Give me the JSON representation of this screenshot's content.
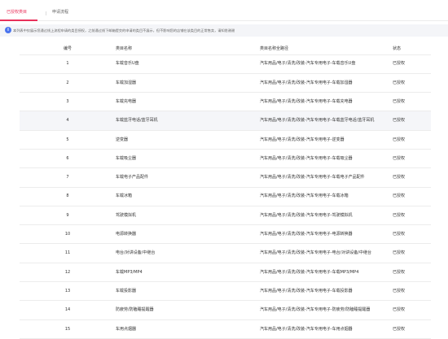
{
  "tabs": {
    "active_label": "已授权类目",
    "other_label": "申请流程"
  },
  "notice": {
    "icon": "info-icon",
    "text": "本列表中仅展示您通过线上流程申请的类目授权，之前通过线下邮箱提交的申请的类目不展示，但不影响您的店铺在该类目的正常售卖，请知悉谢谢"
  },
  "table": {
    "columns": [
      "编号",
      "类目名称",
      "类目名称全路径",
      "状态"
    ],
    "rows": [
      {
        "id": "1",
        "name": "车载音乐U盘",
        "path": "汽车用品/电子/清洗/改装-汽车专用电子-车载音乐U盘",
        "status": "已授权"
      },
      {
        "id": "2",
        "name": "车载加湿器",
        "path": "汽车用品/电子/清洗/改装-汽车专用电子-车载加湿器",
        "status": "已授权"
      },
      {
        "id": "3",
        "name": "车载充电器",
        "path": "汽车用品/电子/清洗/改装-汽车专用电子-车载充电器",
        "status": "已授权"
      },
      {
        "id": "4",
        "name": "车载蓝牙电话/蓝牙耳机",
        "path": "汽车用品/电子/清洗/改装-汽车专用电子-车载蓝牙电话/蓝牙耳机",
        "status": "已授权"
      },
      {
        "id": "5",
        "name": "逆变器",
        "path": "汽车用品/电子/清洗/改装-汽车专用电子-逆变器",
        "status": "已授权"
      },
      {
        "id": "6",
        "name": "车载吸尘器",
        "path": "汽车用品/电子/清洗/改装-汽车专用电子-车载吸尘器",
        "status": "已授权"
      },
      {
        "id": "7",
        "name": "车载电子产品配件",
        "path": "汽车用品/电子/清洗/改装-汽车专用电子-车载电子产品配件",
        "status": "已授权"
      },
      {
        "id": "8",
        "name": "车载冰箱",
        "path": "汽车用品/电子/清洗/改装-汽车专用电子-车载冰箱",
        "status": "已授权"
      },
      {
        "id": "9",
        "name": "驾驶模拟机",
        "path": "汽车用品/电子/清洗/改装-汽车专用电子-驾驶模拟机",
        "status": "已授权"
      },
      {
        "id": "10",
        "name": "电源转换器",
        "path": "汽车用品/电子/清洗/改装-汽车专用电子-电源转换器",
        "status": "已授权"
      },
      {
        "id": "11",
        "name": "电台/对讲设备/中继台",
        "path": "汽车用品/电子/清洗/改装-汽车专用电子-电台/对讲设备/中继台",
        "status": "已授权"
      },
      {
        "id": "12",
        "name": "车载MP3/MP4",
        "path": "汽车用品/电子/清洗/改装-汽车专用电子-车载MP3/MP4",
        "status": "已授权"
      },
      {
        "id": "13",
        "name": "车载投影器",
        "path": "汽车用品/电子/清洗/改装-汽车专用电子-车载投影器",
        "status": "已授权"
      },
      {
        "id": "14",
        "name": "防疲劳/防瞌睡提醒器",
        "path": "汽车用品/电子/清洗/改装-汽车专用电子-防疲劳/防瞌睡提醒器",
        "status": "已授权"
      },
      {
        "id": "15",
        "name": "车用点烟器",
        "path": "汽车用品/电子/清洗/改装-汽车专用电子-车用点烟器",
        "status": "已授权"
      }
    ]
  },
  "colors": {
    "accent": "#e8305a",
    "info": "#4a74ee",
    "highlight_row": "#f5f6f9"
  }
}
